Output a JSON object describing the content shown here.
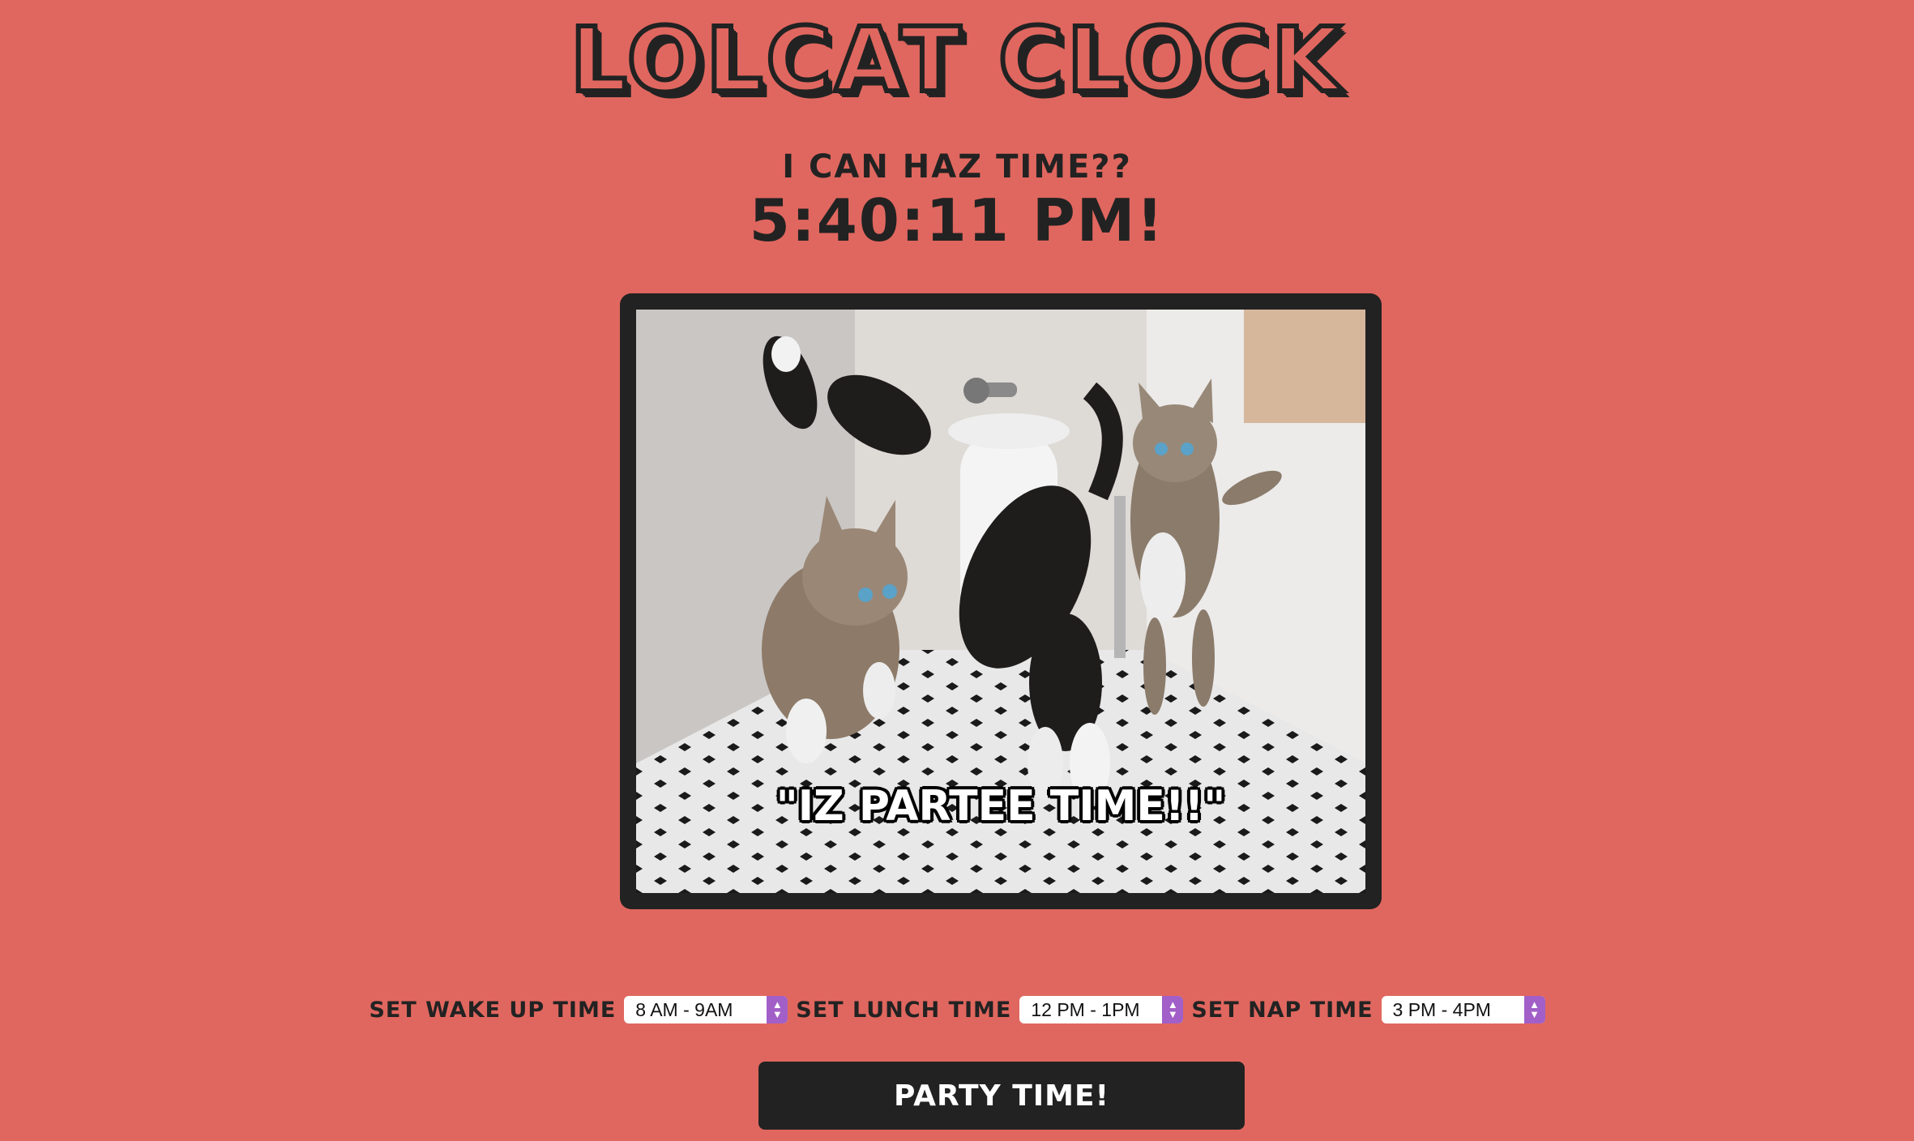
{
  "header": {
    "title": "LOLCAT CLOCK",
    "subtitle": "I CAN HAZ TIME??",
    "time_readout": "5:40:11 PM!"
  },
  "photo": {
    "caption": "\"IZ PARTEE TIME!!\""
  },
  "controls": {
    "wake_up": {
      "label": "SET WAKE UP TIME",
      "value": "8 AM - 9AM"
    },
    "lunch": {
      "label": "SET LUNCH TIME",
      "value": "12 PM - 1PM"
    },
    "nap": {
      "label": "SET NAP TIME",
      "value": "3 PM - 4PM"
    }
  },
  "party_button": {
    "label": "PARTY TIME!"
  },
  "colors": {
    "background": "#e0675f",
    "ink": "#222222",
    "select_arrow": "#a15fc7"
  }
}
